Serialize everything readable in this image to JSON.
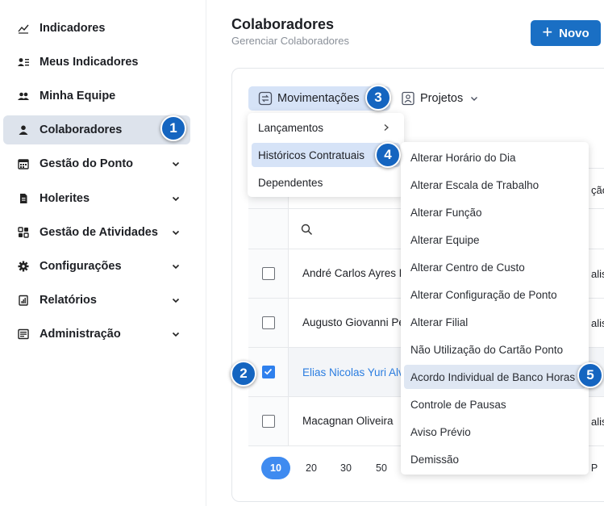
{
  "sidebar": {
    "items": [
      {
        "label": "Indicadores",
        "icon": "chart-line-icon",
        "has_chevron": false
      },
      {
        "label": "Meus Indicadores",
        "icon": "user-list-icon",
        "has_chevron": false
      },
      {
        "label": "Minha Equipe",
        "icon": "users-icon",
        "has_chevron": false
      },
      {
        "label": "Colaboradores",
        "icon": "user-icon",
        "has_chevron": false,
        "active": true
      },
      {
        "label": "Gestão do Ponto",
        "icon": "calendar-icon",
        "has_chevron": true
      },
      {
        "label": "Holerites",
        "icon": "document-icon",
        "has_chevron": true
      },
      {
        "label": "Gestão de Atividades",
        "icon": "grid-icon",
        "has_chevron": true
      },
      {
        "label": "Configurações",
        "icon": "gear-icon",
        "has_chevron": true
      },
      {
        "label": "Relatórios",
        "icon": "report-icon",
        "has_chevron": true
      },
      {
        "label": "Administração",
        "icon": "admin-icon",
        "has_chevron": true
      }
    ]
  },
  "header": {
    "title": "Colaboradores",
    "subtitle": "Gerenciar Colaboradores",
    "new_button": "Novo"
  },
  "tabs": {
    "movimentacoes": "Movimentações",
    "projetos": "Projetos"
  },
  "menu_movimentacoes": [
    {
      "label": "Lançamentos",
      "has_submenu": true
    },
    {
      "label": "Históricos Contratuais",
      "active": true
    },
    {
      "label": "Dependentes"
    }
  ],
  "menu_historicos": [
    "Alterar Horário do Dia",
    "Alterar Escala de Trabalho",
    "Alterar Função",
    "Alterar Equipe",
    "Alterar Centro de Custo",
    "Alterar Configuração de Ponto",
    "Alterar Filial",
    "Não Utilização do Cartão Ponto",
    "Acordo Individual de Banco Horas",
    "Controle de Pausas",
    "Aviso Prévio",
    "Demissão"
  ],
  "table": {
    "header_fragment": "ção",
    "rows": [
      {
        "name": "André Carlos Ayres P",
        "right": "alist",
        "checked": false
      },
      {
        "name": "Augusto Giovanni Pe",
        "right": "alist",
        "checked": false
      },
      {
        "name": "Elias Nicolas Yuri Alv",
        "right": "",
        "checked": true
      },
      {
        "name": "Macagnan Oliveira",
        "right": "alist",
        "checked": false
      }
    ]
  },
  "pagination": {
    "sizes": [
      "10",
      "20",
      "30",
      "50"
    ],
    "active": "10",
    "trailing": "P"
  },
  "steps": [
    "1",
    "2",
    "3",
    "4",
    "5"
  ],
  "colors": {
    "accent": "#1a6fc4",
    "badge": "#1565c0",
    "active_bg": "#d6e3f7",
    "link": "#2b7de0"
  }
}
